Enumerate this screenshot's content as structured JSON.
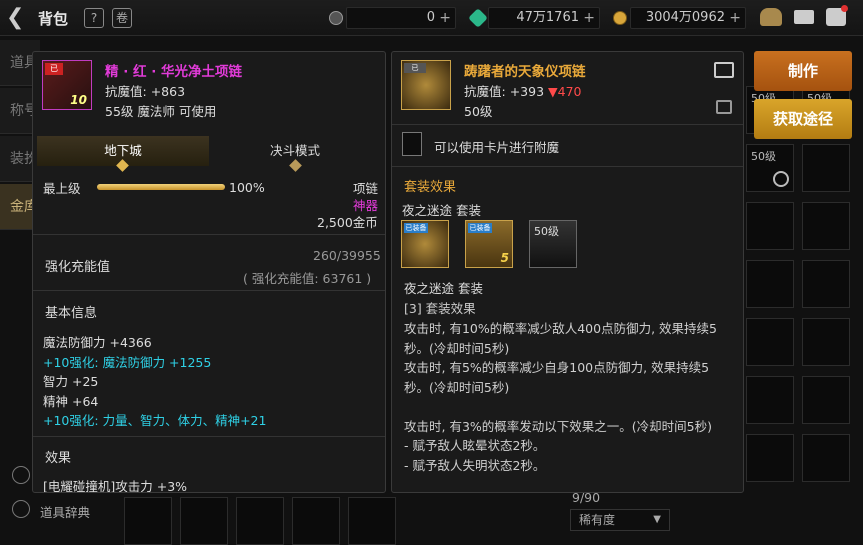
{
  "topbar": {
    "title": "背包",
    "currency": [
      {
        "value": "0",
        "icon": "c-coin-icon",
        "color": "#888888"
      },
      {
        "value": "47万1761",
        "icon": "gem-icon",
        "color": "#2bb88a"
      },
      {
        "value": "3004万0962",
        "icon": "gold-coin-icon",
        "color": "#d9a63a"
      }
    ]
  },
  "bg_tabs": [
    "道具",
    "称号",
    "装扮",
    "金库"
  ],
  "bg_bottom": {
    "dict_label": "道具辞典",
    "count": "9/90",
    "rarity_label": "稀有度"
  },
  "buttons": {
    "craft": "制作",
    "obtain": "获取途径"
  },
  "slot_texts": [
    "50级",
    "50级",
    "50级"
  ],
  "left": {
    "name": "精 · 红 · 华光净土项链",
    "resist_label": "抗魔值:",
    "resist_value": "+863",
    "level_line": "55级 魔法师 可使用",
    "icon_level": "10",
    "tabs": [
      "地下城",
      "决斗模式"
    ],
    "grade_label": "最上级",
    "grade_percent": "100%",
    "grade_fraction": 1.0,
    "item_type": "项链",
    "rarity": "神器",
    "price": "2,500金币",
    "charge_label": "强化充能值",
    "charge_value": "260/39955",
    "charge_total": "( 强化充能值: 63761 )",
    "basic_info_title": "基本信息",
    "stats": [
      {
        "text": "魔法防御力 +4366",
        "style": "normal"
      },
      {
        "text": "+10强化: 魔法防御力 +1255",
        "style": "cyan"
      },
      {
        "text": "智力 +25",
        "style": "normal"
      },
      {
        "text": "精神 +64",
        "style": "normal"
      },
      {
        "text": "+10强化: 力量、智力、体力、精神+21",
        "style": "cyan"
      }
    ],
    "effect_title": "效果",
    "effect_line": "[电耀碰撞机]攻击力 +3%"
  },
  "right": {
    "name": "踌躇者的天象仪项链",
    "resist_label": "抗魔值:",
    "resist_value": "+393",
    "resist_diff": "▼470",
    "level": "50级",
    "enchant_text": "可以使用卡片进行附魔",
    "set_title": "套装效果",
    "set_name": "夜之迷途  套装",
    "set_items": [
      {
        "badge": "已装备",
        "level": ""
      },
      {
        "badge": "已装备",
        "level": "5"
      },
      {
        "badge": "",
        "level": "50级"
      }
    ],
    "set_name2": "夜之迷途  套装",
    "set_effect_title": "[3] 套装效果",
    "lines": [
      "攻击时, 有10%的概率减少敌人400点防御力, 效果持续5",
      "秒。(冷却时间5秒)",
      "攻击时, 有5%的概率减少自身100点防御力, 效果持续5",
      "秒。(冷却时间5秒)",
      "",
      "攻击时, 有3%的概率发动以下效果之一。(冷却时间5秒)",
      "- 赋予敌人眩晕状态2秒。",
      "- 赋予敌人失明状态2秒。"
    ]
  }
}
